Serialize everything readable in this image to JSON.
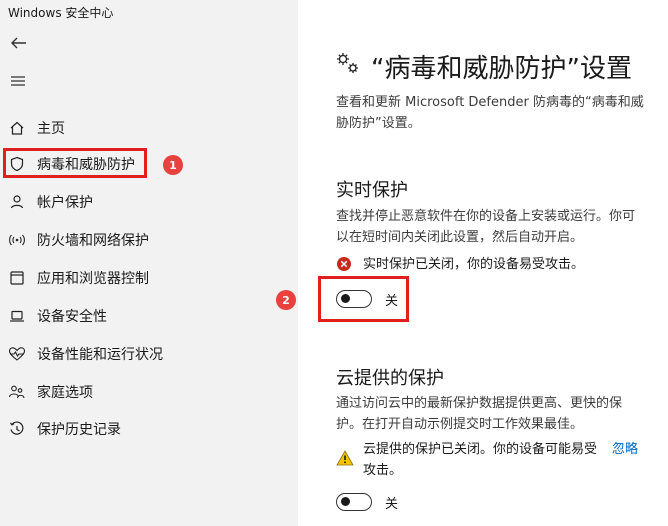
{
  "window": {
    "title": "Windows 安全中心"
  },
  "sidebar": {
    "items": [
      {
        "label": "主页",
        "icon": "home-icon"
      },
      {
        "label": "病毒和威胁防护",
        "icon": "shield-icon",
        "selected": true
      },
      {
        "label": "帐户保护",
        "icon": "person-icon"
      },
      {
        "label": "防火墙和网络保护",
        "icon": "antenna-icon"
      },
      {
        "label": "应用和浏览器控制",
        "icon": "app-window-icon"
      },
      {
        "label": "设备安全性",
        "icon": "laptop-icon"
      },
      {
        "label": "设备性能和运行状况",
        "icon": "heart-pulse-icon"
      },
      {
        "label": "家庭选项",
        "icon": "family-icon"
      },
      {
        "label": "保护历史记录",
        "icon": "history-icon"
      }
    ]
  },
  "annotations": {
    "step1": "1",
    "step2": "2"
  },
  "main": {
    "title": "“病毒和威胁防护”设置",
    "description": "查看和更新 Microsoft Defender 防病毒的“病毒和威胁防护”设置。",
    "realtime": {
      "title": "实时保护",
      "description": "查找并停止恶意软件在你的设备上安装或运行。你可以在短时间内关闭此设置，然后自动开启。",
      "status": "实时保护已关闭，你的设备易受攻击。",
      "toggle_label": "关",
      "toggle_on": false
    },
    "cloud": {
      "title": "云提供的保护",
      "description": "通过访问云中的最新保护数据提供更高、更快的保护。在打开自动示例提交时工作效果最佳。",
      "status": "云提供的保护已关闭。你的设备可能易受攻击。",
      "dismiss_label": "忽略",
      "toggle_label": "关",
      "toggle_on": false
    }
  },
  "colors": {
    "accent_red": "#e0201e",
    "link": "#0067c0",
    "sidebar_bg": "#f2f2f2"
  }
}
